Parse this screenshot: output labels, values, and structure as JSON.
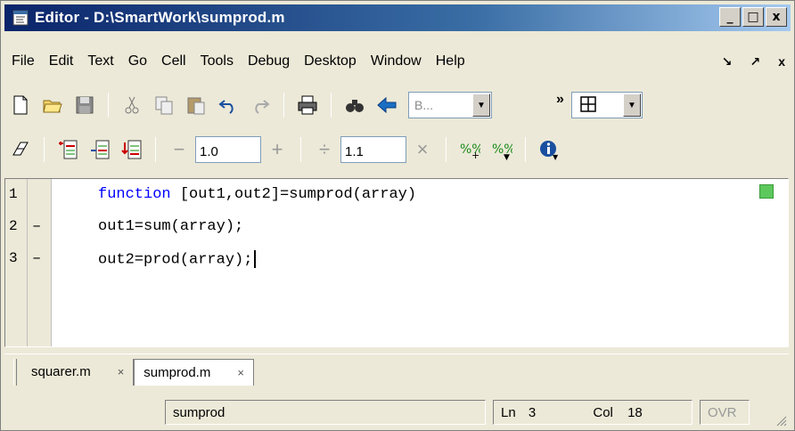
{
  "window": {
    "title": "Editor - D:\\SmartWork\\sumprod.m",
    "controls": [
      "_",
      "□",
      "x"
    ]
  },
  "menu": {
    "items": [
      "File",
      "Edit",
      "Text",
      "Go",
      "Cell",
      "Tools",
      "Debug",
      "Desktop",
      "Window",
      "Help"
    ],
    "right_glyphs": [
      "↘",
      "↗",
      "x"
    ]
  },
  "toolbar1": {
    "icons": [
      "new-file-icon",
      "open-folder-icon",
      "save-icon",
      "cut-icon",
      "copy-icon",
      "paste-icon",
      "undo-icon",
      "redo-icon",
      "print-icon",
      "find-icon",
      "back-icon"
    ],
    "stack_combo_value": "B...",
    "overflow_glyph": "»"
  },
  "toolbar2": {
    "decrement_glyph": "−",
    "increment_value": "1.0",
    "increment_glyph": "+",
    "divide_glyph": "÷",
    "divide_value": "1.1",
    "multiply_glyph": "×"
  },
  "editor": {
    "lines": [
      {
        "number": "1",
        "marker": "",
        "keyword": "function",
        "rest": " [out1,out2]=sumprod(array)"
      },
      {
        "number": "2",
        "marker": "–",
        "keyword": "",
        "rest": "out1=sum(array);"
      },
      {
        "number": "3",
        "marker": "–",
        "keyword": "",
        "rest": "out2=prod(array);"
      }
    ],
    "colors": {
      "keyword": "#0000ff",
      "status_ok": "#5cc85c"
    }
  },
  "tabs": [
    {
      "label": "squarer.m",
      "close": "×",
      "active": false
    },
    {
      "label": "sumprod.m",
      "close": "×",
      "active": true
    }
  ],
  "status": {
    "function_name": "sumprod",
    "ln_label": "Ln",
    "ln_value": "3",
    "col_label": "Col",
    "col_value": "18",
    "mode": "OVR"
  }
}
